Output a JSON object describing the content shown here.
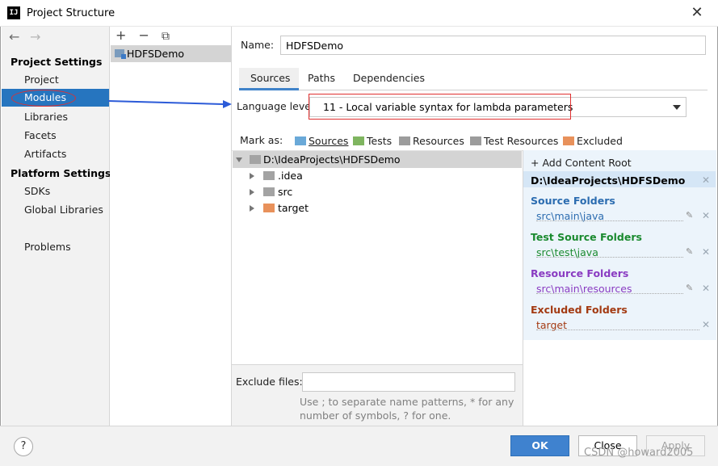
{
  "window": {
    "title": "Project Structure",
    "app_icon": "IJ"
  },
  "sidebar": {
    "back_icon": "←",
    "forward_icon": "→",
    "project_settings_header": "Project Settings",
    "project_settings_items": [
      "Project",
      "Modules",
      "Libraries",
      "Facets",
      "Artifacts"
    ],
    "platform_settings_header": "Platform Settings",
    "platform_settings_items": [
      "SDKs",
      "Global Libraries"
    ],
    "problems": "Problems",
    "selected": "Modules"
  },
  "modules": {
    "toolbar": [
      "+",
      "−",
      "⧉"
    ],
    "items": [
      "HDFSDemo"
    ]
  },
  "name_field": {
    "label": "Name:",
    "value": "HDFSDemo"
  },
  "tabs": [
    "Sources",
    "Paths",
    "Dependencies"
  ],
  "active_tab": "Sources",
  "language_level": {
    "label": "Language level:",
    "value": "11 - Local variable syntax for lambda parameters"
  },
  "mark_as": {
    "label": "Mark as:",
    "items": [
      {
        "label": "Sources",
        "color": "#6aa9d8"
      },
      {
        "label": "Tests",
        "color": "#7fb560"
      },
      {
        "label": "Resources",
        "color": "#9c9c9c"
      },
      {
        "label": "Test Resources",
        "color": "#9c9c9c"
      },
      {
        "label": "Excluded",
        "color": "#e8915b"
      }
    ]
  },
  "tree": {
    "root": "D:\\IdeaProjects\\HDFSDemo",
    "children": [
      {
        "name": ".idea",
        "color": "#a3a3a3"
      },
      {
        "name": "src",
        "color": "#a3a3a3"
      },
      {
        "name": "target",
        "color": "#e8915b"
      }
    ]
  },
  "exclude_files": {
    "label": "Exclude files:",
    "value": "",
    "hint_line1": "Use ; to separate name patterns, * for any",
    "hint_line2": "number of symbols, ? for one."
  },
  "content_root": {
    "add_label": "+ Add Content Root",
    "path": "D:\\IdeaProjects\\HDFSDemo",
    "groups": [
      {
        "header": "Source Folders",
        "path": "src\\main\\java",
        "color": "#2b6cb0"
      },
      {
        "header": "Test Source Folders",
        "path": "src\\test\\java",
        "color": "#1a8a2f"
      },
      {
        "header": "Resource Folders",
        "path": "src\\main\\resources",
        "color": "#8a3cc2"
      },
      {
        "header": "Excluded Folders",
        "path": "target",
        "color": "#a33a12"
      }
    ]
  },
  "footer": {
    "help": "?",
    "ok": "OK",
    "close": "Close",
    "apply": "Apply",
    "watermark": "CSDN @howard2005"
  },
  "colors": {
    "selection": "#2675bf",
    "primary_button": "#3f82cf",
    "annotation": "#e03030",
    "annotation_arrow": "#2c5bd8"
  }
}
